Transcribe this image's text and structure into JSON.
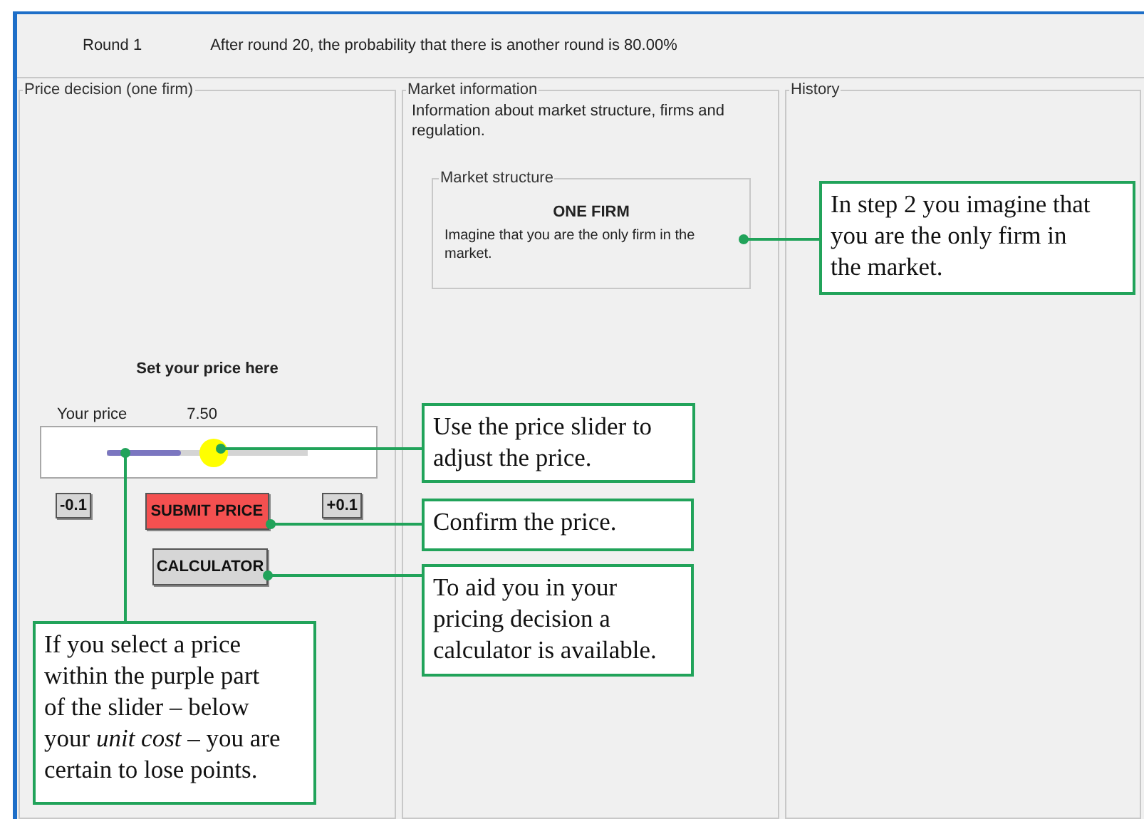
{
  "header": {
    "round": "Round 1",
    "message": "After round 20, the probability that there is another round is 80.00%"
  },
  "price_panel": {
    "title": "Price decision (one firm)",
    "heading": "Set your price here",
    "price_label": "Your price",
    "price_value": "7.50",
    "slider": {
      "level": 0.53,
      "cost_zone": {
        "level": 0.37
      }
    },
    "minus_button": "-0.1",
    "submit_button": "SUBMIT PRICE",
    "plus_button": "+0.1",
    "calculator_button": "CALCULATOR"
  },
  "market_panel": {
    "title": "Market information",
    "intro": "Information about market structure, firms and regulation.",
    "structure": {
      "title": "Market structure",
      "heading": "ONE FIRM",
      "text": "Imagine that you are the only firm in the market."
    }
  },
  "history_panel": {
    "title": "History"
  },
  "callouts": [
    {
      "kind": "market",
      "text": "In step 2 you imagine that you are the only firm in the market."
    },
    {
      "kind": "slider",
      "text": "Use the price slider to adjust the price."
    },
    {
      "kind": "submit",
      "text": "Confirm the price."
    },
    {
      "kind": "calculator",
      "text": "To aid you in your pricing decision a calculator is available."
    },
    {
      "kind": "cost",
      "text": "If you select a price within the purple part of the slider – below your *unit cost* – you are certain to lose points."
    }
  ]
}
